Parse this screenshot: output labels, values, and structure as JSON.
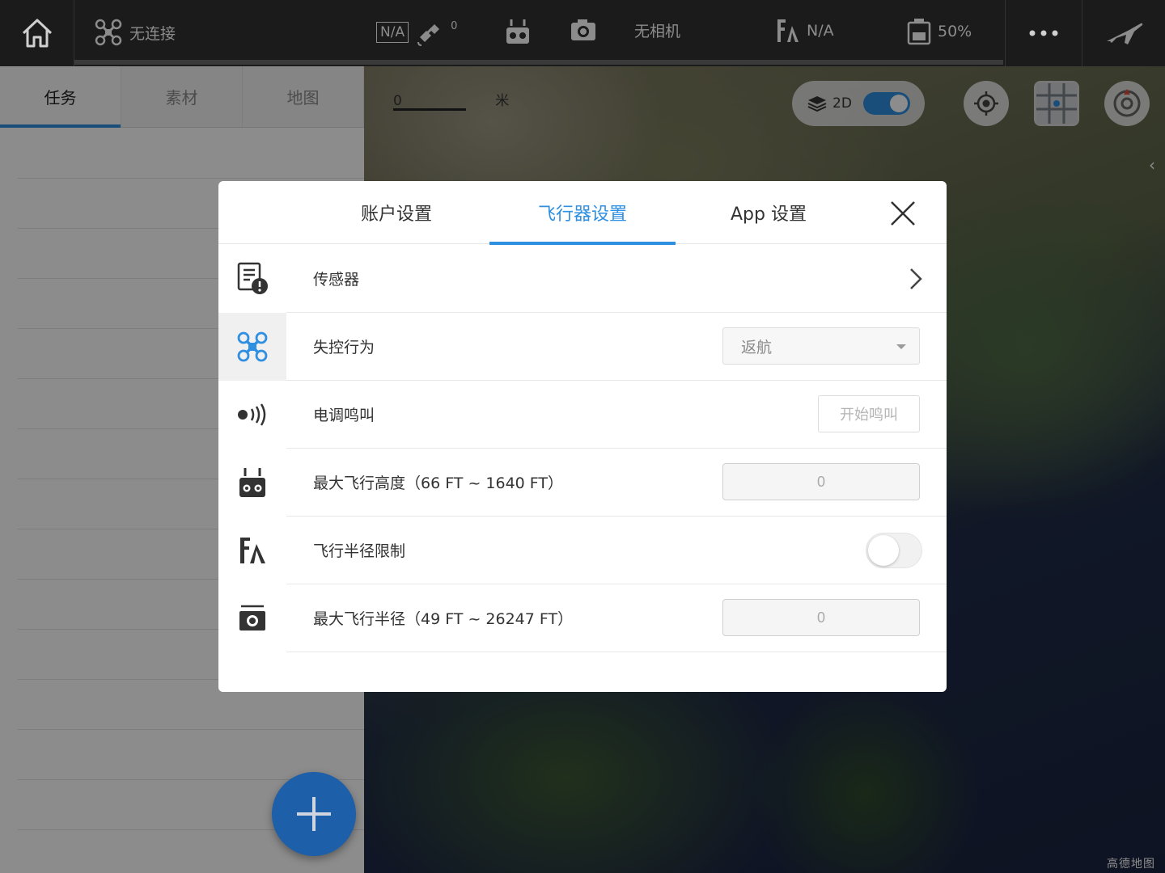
{
  "topbar": {
    "connection_label": "无连接",
    "gps_box": "N/A",
    "satellite_count": "0",
    "camera_label": "无相机",
    "flight_mode_value": "N/A",
    "battery_value": "50%"
  },
  "left_panel": {
    "tabs": [
      {
        "label": "任务",
        "active": true
      },
      {
        "label": "素材",
        "active": false
      },
      {
        "label": "地图",
        "active": false
      }
    ],
    "add_button_label": "+"
  },
  "map": {
    "scale_label_start": "0",
    "scale_label_unit": "米",
    "mode_label": "2D",
    "watermark": "高德地图"
  },
  "modal": {
    "tabs": [
      {
        "label": "账户设置",
        "active": false
      },
      {
        "label": "飞行器设置",
        "active": true
      },
      {
        "label": "App 设置",
        "active": false
      }
    ],
    "side_icons": [
      "checklist-warning-icon",
      "drone-icon",
      "beep-icon",
      "remote-controller-icon",
      "flight-mode-icon",
      "camera-icon",
      "more-icon"
    ],
    "rows": {
      "sensor_label": "传感器",
      "failsafe_label": "失控行为",
      "failsafe_value": "返航",
      "esc_beep_label": "电调鸣叫",
      "esc_beep_button": "开始鸣叫",
      "max_altitude_label": "最大飞行高度（66 FT ~ 1640 FT）",
      "max_altitude_value": "0",
      "radius_limit_label": "飞行半径限制",
      "radius_limit_on": false,
      "max_radius_label": "最大飞行半径（49 FT ~ 26247 FT）",
      "max_radius_value": "0"
    }
  },
  "colors": {
    "accent": "#2f8fe0",
    "fab": "#1d5fa8",
    "topbar": "#1b1b1b"
  }
}
